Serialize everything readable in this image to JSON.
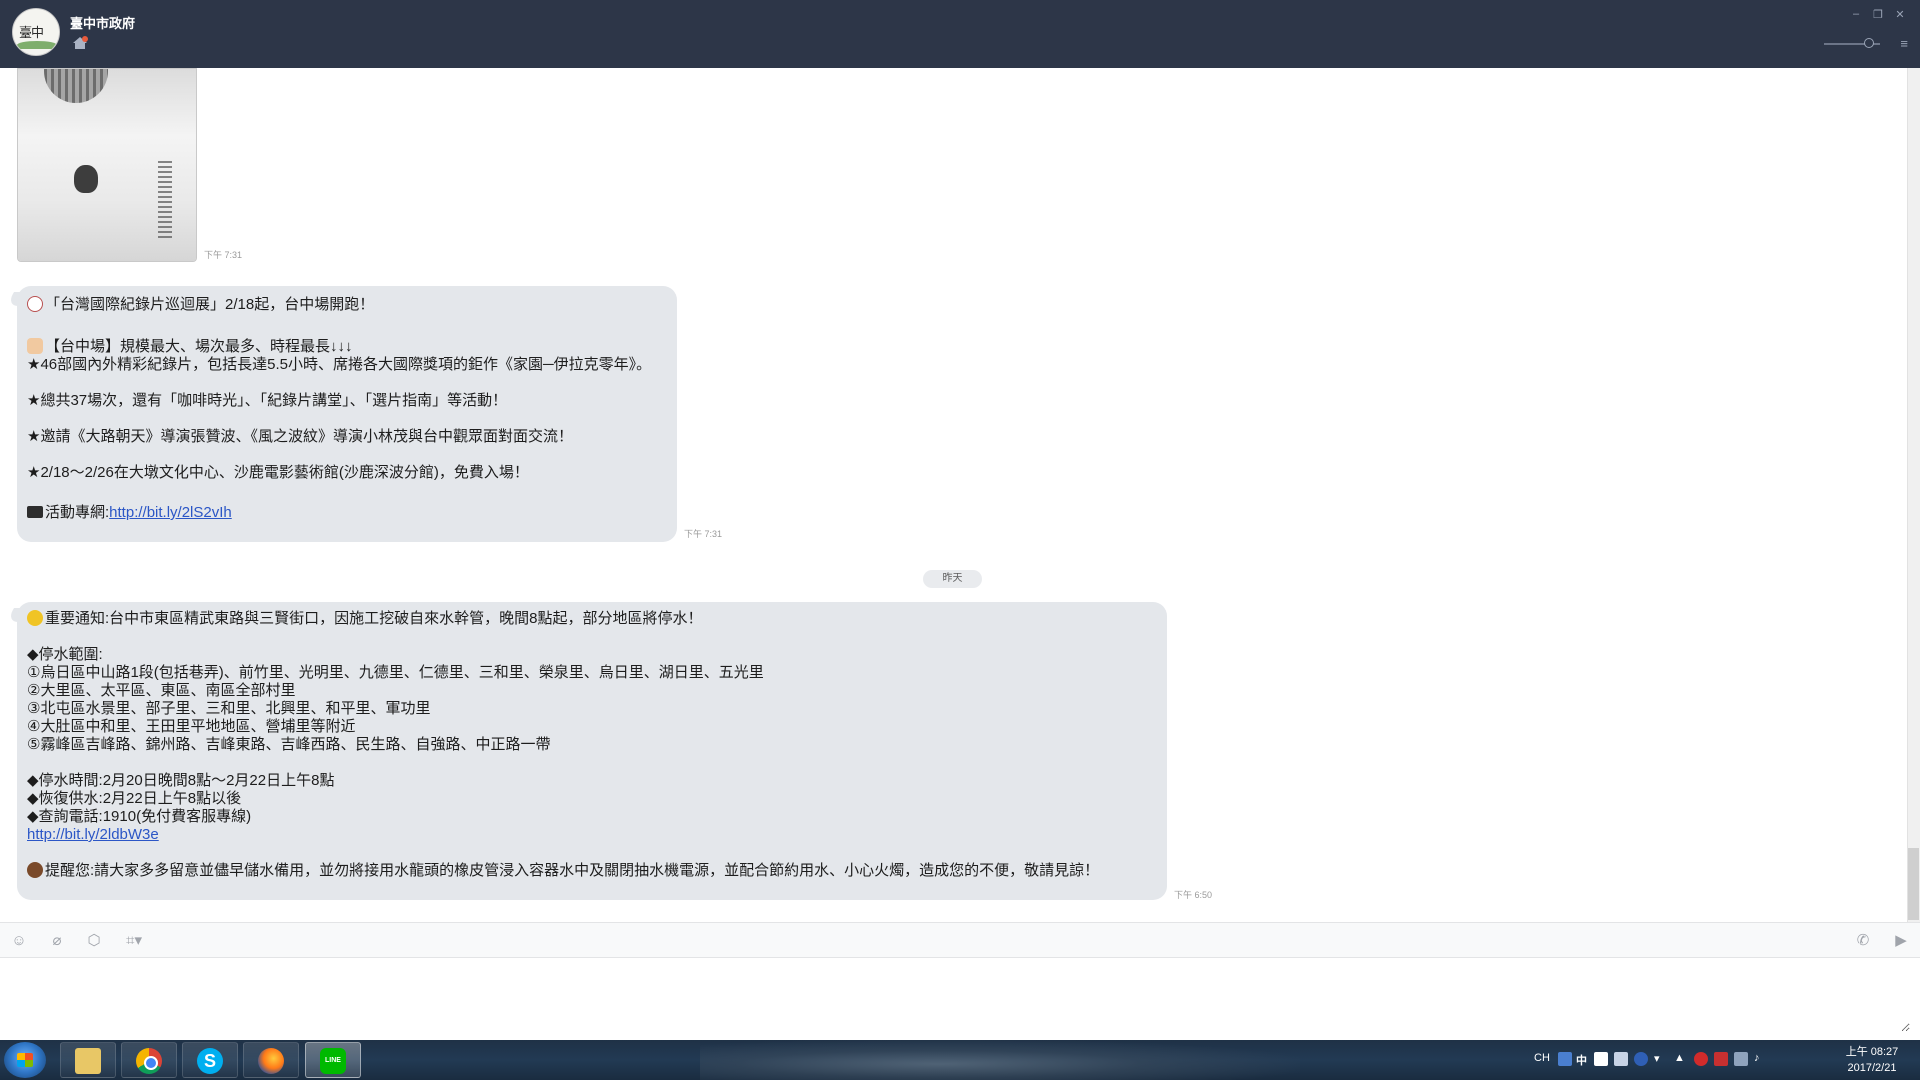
{
  "window": {
    "title": "臺中市政府"
  },
  "chat": {
    "image_message": {
      "time": "下午 7:31"
    },
    "message1": {
      "time": "下午 7:31",
      "lines": [
        "「台灣國際紀錄片巡迴展」2/18起，台中場開跑！",
        "",
        "【台中場】規模最大、場次最多、時程最長↓↓↓",
        "★46部國內外精彩紀錄片，包括長達5.5小時、席捲各大國際獎項的鉅作《家園─伊拉克零年》。",
        "",
        "★總共37場次，還有「咖啡時光」、「紀錄片講堂」、「選片指南」等活動！",
        "",
        "★邀請《大路朝天》導演張贊波、《風之波紋》導演小林茂與台中觀眾面對面交流！",
        "",
        "★2/18～2/26在大墩文化中心、沙鹿電影藝術館(沙鹿深波分館)，免費入場！",
        ""
      ],
      "link_prefix": "活動專網:",
      "link": "http://bit.ly/2lS2vIh"
    },
    "date_separator": "昨天",
    "message2": {
      "time": "下午 6:50",
      "lines_before_link": [
        "重要通知:台中市東區精武東路與三賢街口，因施工挖破自來水幹管，晚間8點起，部分地區將停水！",
        "",
        "◆停水範圍:",
        "①烏日區中山路1段(包括巷弄)、前竹里、光明里、九德里、仁德里、三和里、榮泉里、烏日里、湖日里、五光里",
        "②大里區、太平區、東區、南區全部村里",
        "③北屯區水景里、部子里、三和里、北興里、和平里、軍功里",
        "④大肚區中和里、王田里平地地區、營埔里等附近",
        "⑤霧峰區吉峰路、錦州路、吉峰東路、吉峰西路、民生路、自強路、中正路一帶",
        "",
        "◆停水時間:2月20日晚間8點～2月22日上午8點",
        "◆恢復供水:2月22日上午8點以後",
        "◆查詢電話:1910(免付費客服專線)"
      ],
      "link": "http://bit.ly/2ldbW3e",
      "closing": "提醒您:請大家多多留意並儘早儲水備用，並勿將接用水龍頭的橡皮管浸入容器水中及關閉抽水機電源，並配合節約用水、小心火燭，造成您的不便，敬請見諒！"
    }
  },
  "input": {
    "placeholder": ""
  },
  "taskbar": {
    "apps": [
      {
        "name": "explorer",
        "label": ""
      },
      {
        "name": "chrome",
        "label": ""
      },
      {
        "name": "skype",
        "label": "S"
      },
      {
        "name": "firefox",
        "label": ""
      },
      {
        "name": "line",
        "label": "LINE"
      }
    ],
    "tray_language": "CH",
    "tray_ime": "中",
    "clock_time": "上午 08:27",
    "clock_date": "2017/2/21"
  },
  "colors": {
    "titlebar": "#2d3648",
    "bubble": "#e4e7eb",
    "link": "#2b56c6",
    "line_green": "#00b900"
  },
  "icons": [
    "home-icon",
    "minimize-icon",
    "maximize-icon",
    "close-icon",
    "menu-icon",
    "emoji-icon",
    "attach-icon",
    "keep-icon",
    "screenshot-icon",
    "call-icon",
    "send-icon"
  ]
}
